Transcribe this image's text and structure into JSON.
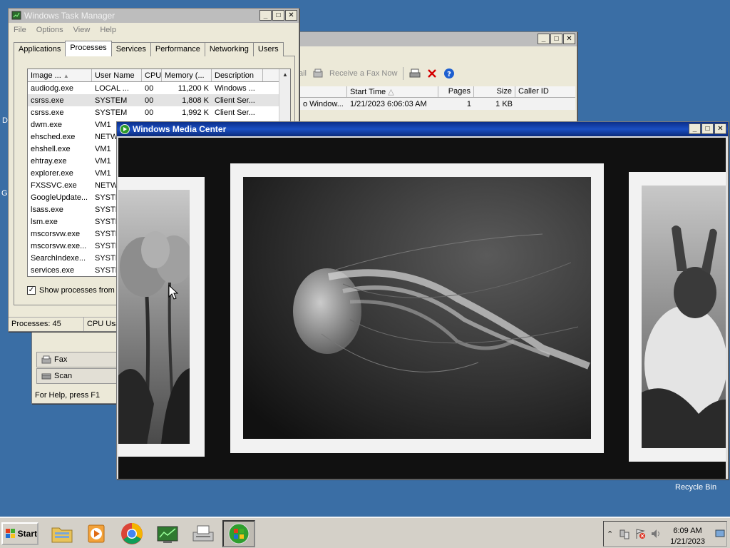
{
  "desktop": {
    "recycle_bin_label": "Recycle Bin",
    "left_edge_letters": [
      "D",
      "G"
    ]
  },
  "task_manager": {
    "title": "Windows Task Manager",
    "menu": [
      "File",
      "Options",
      "View",
      "Help"
    ],
    "tabs": [
      "Applications",
      "Processes",
      "Services",
      "Performance",
      "Networking",
      "Users"
    ],
    "selected_tab": "Processes",
    "columns": [
      "Image ...",
      "User Name",
      "CPU",
      "Memory (...",
      "Description"
    ],
    "rows": [
      {
        "image": "audiodg.exe",
        "user": "LOCAL ...",
        "cpu": "00",
        "mem": "11,200 K",
        "desc": "Windows ..."
      },
      {
        "image": "csrss.exe",
        "user": "SYSTEM",
        "cpu": "00",
        "mem": "1,808 K",
        "desc": "Client Ser..."
      },
      {
        "image": "csrss.exe",
        "user": "SYSTEM",
        "cpu": "00",
        "mem": "1,992 K",
        "desc": "Client Ser..."
      },
      {
        "image": "dwm.exe",
        "user": "VM1",
        "cpu": "",
        "mem": "",
        "desc": ""
      },
      {
        "image": "ehsched.exe",
        "user": "NETW",
        "cpu": "",
        "mem": "",
        "desc": ""
      },
      {
        "image": "ehshell.exe",
        "user": "VM1",
        "cpu": "",
        "mem": "",
        "desc": ""
      },
      {
        "image": "ehtray.exe",
        "user": "VM1",
        "cpu": "",
        "mem": "",
        "desc": ""
      },
      {
        "image": "explorer.exe",
        "user": "VM1",
        "cpu": "",
        "mem": "",
        "desc": ""
      },
      {
        "image": "FXSSVC.exe",
        "user": "NETW",
        "cpu": "",
        "mem": "",
        "desc": ""
      },
      {
        "image": "GoogleUpdate...",
        "user": "SYSTE",
        "cpu": "",
        "mem": "",
        "desc": ""
      },
      {
        "image": "lsass.exe",
        "user": "SYSTE",
        "cpu": "",
        "mem": "",
        "desc": ""
      },
      {
        "image": "lsm.exe",
        "user": "SYSTE",
        "cpu": "",
        "mem": "",
        "desc": ""
      },
      {
        "image": "mscorsvw.exe",
        "user": "SYSTE",
        "cpu": "",
        "mem": "",
        "desc": ""
      },
      {
        "image": "mscorsvw.exe...",
        "user": "SYSTE",
        "cpu": "",
        "mem": "",
        "desc": ""
      },
      {
        "image": "SearchIndexe...",
        "user": "SYSTE",
        "cpu": "",
        "mem": "",
        "desc": ""
      },
      {
        "image": "services.exe",
        "user": "SYSTE",
        "cpu": "",
        "mem": "",
        "desc": ""
      }
    ],
    "show_all_label": "Show processes from a",
    "status_processes": "Processes: 45",
    "status_cpu": "CPU Usa"
  },
  "fax_window": {
    "toolbar_receive": "Receive a Fax Now",
    "toolbar_partial": "ail",
    "columns": [
      "Start Time",
      "Pages",
      "Size",
      "Caller ID"
    ],
    "row": {
      "prefix": "o Window...",
      "start": "1/21/2023 6:06:03 AM",
      "pages": "1",
      "size": "1 KB",
      "caller": ""
    },
    "side_fax": "Fax",
    "side_scan": "Scan",
    "status": "For Help, press F1"
  },
  "media_center": {
    "title": "Windows Media Center"
  },
  "taskbar": {
    "start_label": "Start",
    "time": "6:09 AM",
    "date": "1/21/2023"
  }
}
